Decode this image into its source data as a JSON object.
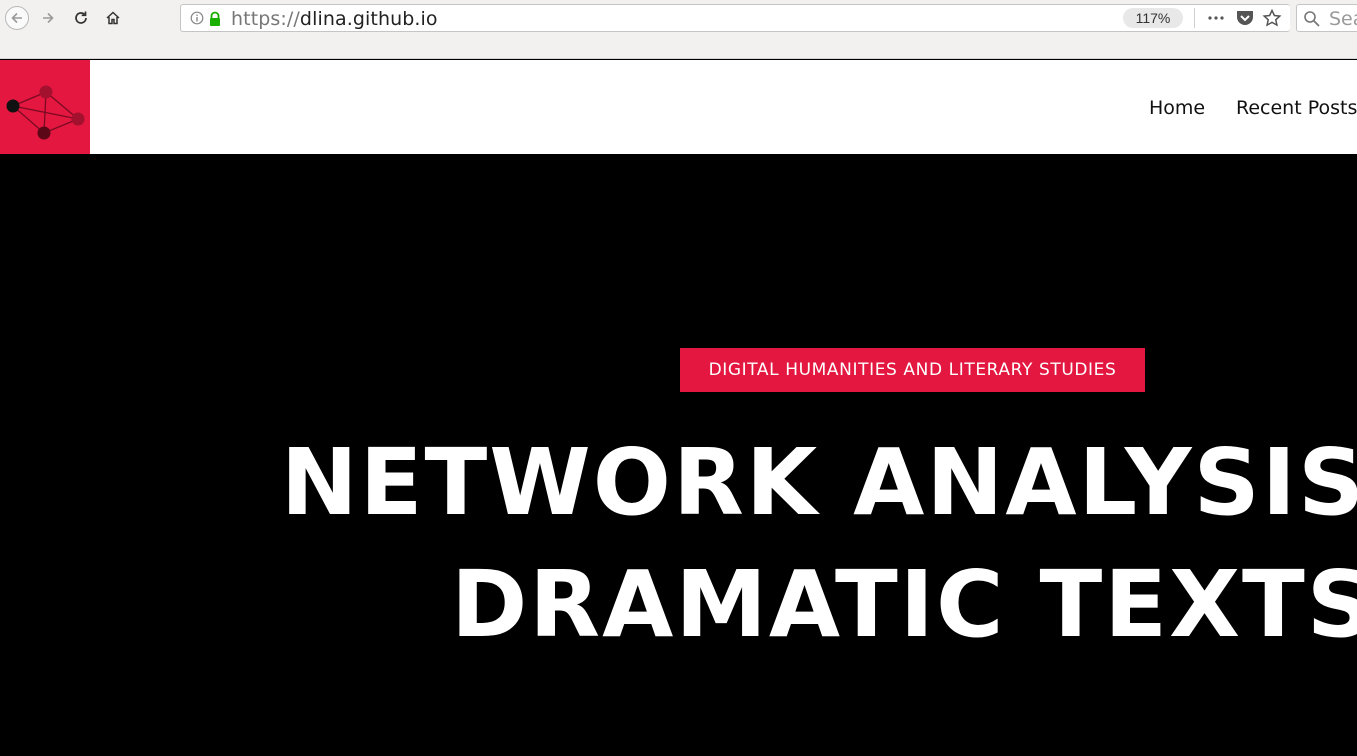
{
  "browser": {
    "url_scheme": "https://",
    "url_host": "dlina.github.io",
    "zoom_level": "117%",
    "search_placeholder": "Search",
    "icons": [
      "back-icon",
      "forward-icon",
      "reload-icon",
      "home-icon",
      "info-icon",
      "lock-icon",
      "more-icon",
      "pocket-icon",
      "star-icon",
      "search-icon"
    ]
  },
  "site": {
    "logo": "network-graph-logo",
    "nav": {
      "home_label": "Home",
      "recent_posts_label": "Recent Posts"
    },
    "accent_color": "#e3173f"
  },
  "hero": {
    "category": "DIGITAL HUMANITIES AND LITERARY STUDIES",
    "title": "NETWORK ANALYSIS OF DRAMATIC TEXTS",
    "background_color": "#000000"
  }
}
